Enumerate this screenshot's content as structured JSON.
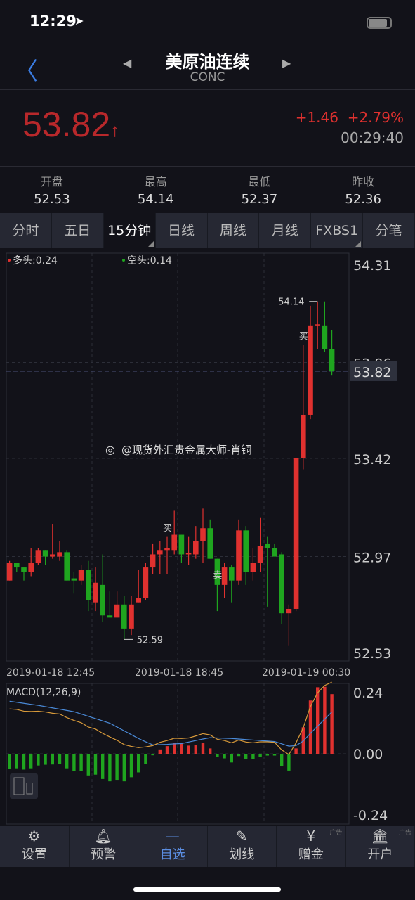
{
  "status": {
    "time": "12:29",
    "location_icon": "location-arrow-icon"
  },
  "header": {
    "title": "美原油连续",
    "subtitle": "CONC",
    "back_icon": "chevron-left-icon"
  },
  "quote": {
    "price": "53.82",
    "arrow": "↑",
    "change": "+1.46",
    "change_pct": "+2.79%",
    "time": "00:29:40",
    "up_color": "#e0312f"
  },
  "stats": [
    {
      "label": "开盘",
      "value": "52.53"
    },
    {
      "label": "最高",
      "value": "54.14"
    },
    {
      "label": "最低",
      "value": "52.37"
    },
    {
      "label": "昨收",
      "value": "52.36"
    }
  ],
  "tabs": [
    {
      "label": "分时"
    },
    {
      "label": "五日"
    },
    {
      "label": "15分钟",
      "active": true
    },
    {
      "label": "日线"
    },
    {
      "label": "周线"
    },
    {
      "label": "月线"
    },
    {
      "label": "FXBS1"
    },
    {
      "label": "分笔"
    }
  ],
  "chart_data": [
    {
      "type": "candlestick",
      "legend": [
        "多头:0.24",
        "空头:0.14"
      ],
      "ylim": [
        52.53,
        54.31
      ],
      "y_ticks": [
        "54.31",
        "53.86",
        "53.42",
        "52.97",
        "52.53"
      ],
      "current_price": "53.82",
      "x_ticks": [
        "2019-01-18 12:45",
        "2019-01-18 18:45",
        "2019-01-19 00:30"
      ],
      "high_label": "54.14",
      "low_label": "52.59",
      "signals": [
        {
          "index": 22,
          "label": "买"
        },
        {
          "index": 29,
          "label": "卖"
        },
        {
          "index": 41,
          "label": "买"
        }
      ],
      "watermark": "@现货外汇贵金属大师-肖铜",
      "colors": {
        "up": "#e0312f",
        "down": "#1fa51f"
      },
      "ohlc": [
        [
          52.86,
          52.94,
          52.95,
          52.86
        ],
        [
          52.94,
          52.92,
          52.94,
          52.9
        ],
        [
          52.92,
          52.9,
          52.92,
          52.86
        ],
        [
          52.9,
          52.94,
          53.01,
          52.88
        ],
        [
          52.94,
          53.0,
          53.01,
          52.93
        ],
        [
          53.0,
          52.97,
          53.0,
          52.93
        ],
        [
          52.97,
          52.98,
          53.12,
          52.96
        ],
        [
          52.97,
          52.99,
          53.04,
          52.95
        ],
        [
          52.99,
          52.86,
          53.0,
          52.86
        ],
        [
          52.87,
          52.86,
          52.9,
          52.8
        ],
        [
          52.86,
          52.91,
          52.93,
          52.84
        ],
        [
          52.91,
          52.77,
          52.95,
          52.72
        ],
        [
          52.76,
          52.85,
          52.92,
          52.72
        ],
        [
          52.84,
          52.7,
          52.98,
          52.67
        ],
        [
          52.7,
          52.69,
          52.81,
          52.69
        ],
        [
          52.69,
          52.75,
          52.81,
          52.69
        ],
        [
          52.75,
          52.64,
          52.79,
          52.59
        ],
        [
          52.64,
          52.75,
          52.79,
          52.61
        ],
        [
          52.76,
          52.78,
          52.91,
          52.76
        ],
        [
          52.78,
          52.92,
          52.94,
          52.77
        ],
        [
          52.92,
          52.98,
          53.03,
          52.89
        ],
        [
          52.98,
          53.0,
          53.04,
          52.89
        ],
        [
          53.0,
          53.01,
          53.06,
          52.89
        ],
        [
          53.0,
          53.07,
          53.18,
          52.98
        ],
        [
          53.07,
          52.98,
          53.07,
          52.94
        ],
        [
          52.98,
          52.985,
          53.06,
          52.93
        ],
        [
          52.98,
          53.04,
          53.11,
          52.96
        ],
        [
          53.04,
          53.1,
          53.19,
          52.94
        ],
        [
          53.1,
          52.96,
          53.14,
          52.96
        ],
        [
          52.96,
          52.84,
          52.96,
          52.72
        ],
        [
          52.84,
          52.92,
          52.94,
          52.78
        ],
        [
          52.92,
          52.86,
          52.93,
          52.76
        ],
        [
          52.86,
          53.09,
          53.14,
          52.84
        ],
        [
          53.09,
          52.9,
          53.11,
          52.84
        ],
        [
          52.9,
          52.94,
          53.01,
          52.86
        ],
        [
          52.94,
          53.02,
          53.15,
          52.9
        ],
        [
          53.03,
          53.01,
          53.06,
          52.74
        ],
        [
          53.01,
          52.97,
          53.03,
          52.97
        ],
        [
          52.98,
          52.71,
          52.99,
          52.66
        ],
        [
          52.71,
          52.73,
          52.75,
          52.56
        ],
        [
          52.73,
          53.42,
          53.42,
          52.72
        ],
        [
          53.42,
          53.62,
          53.94,
          53.37
        ],
        [
          53.62,
          54.03,
          54.12,
          53.6
        ],
        [
          54.03,
          54.035,
          54.14,
          53.92
        ],
        [
          54.03,
          53.92,
          54.14,
          53.91
        ],
        [
          53.92,
          53.82,
          54.01,
          53.8
        ]
      ]
    },
    {
      "type": "macd",
      "title": "MACD(12,26,9)",
      "ylim": [
        -0.24,
        0.24
      ],
      "y_ticks": [
        "0.24",
        "0.00",
        "-0.24"
      ],
      "colors": {
        "dif": "#d89a3a",
        "dea": "#4a8ad8"
      },
      "hist": [
        -0.06,
        -0.057,
        -0.062,
        -0.057,
        -0.046,
        -0.043,
        -0.042,
        -0.039,
        -0.057,
        -0.068,
        -0.068,
        -0.085,
        -0.082,
        -0.099,
        -0.108,
        -0.105,
        -0.108,
        -0.092,
        -0.073,
        -0.041,
        -0.006,
        0.017,
        0.03,
        0.044,
        0.04,
        0.032,
        0.035,
        0.042,
        0.021,
        -0.011,
        -0.018,
        -0.034,
        -0.009,
        -0.02,
        -0.022,
        -0.011,
        -0.007,
        -0.007,
        -0.048,
        -0.066,
        0.021,
        0.104,
        0.209,
        0.261,
        0.263,
        0.234
      ],
      "dif": [
        0.176,
        0.174,
        0.167,
        0.166,
        0.167,
        0.164,
        0.159,
        0.156,
        0.142,
        0.131,
        0.122,
        0.105,
        0.097,
        0.08,
        0.066,
        0.053,
        0.036,
        0.029,
        0.024,
        0.027,
        0.032,
        0.045,
        0.052,
        0.061,
        0.06,
        0.062,
        0.07,
        0.079,
        0.074,
        0.057,
        0.052,
        0.043,
        0.054,
        0.046,
        0.043,
        0.047,
        0.047,
        0.045,
        0.015,
        -0.003,
        0.043,
        0.102,
        0.185,
        0.239,
        0.268,
        0.281
      ],
      "dea": [
        0.206,
        0.202,
        0.198,
        0.194,
        0.19,
        0.185,
        0.18,
        0.175,
        0.17,
        0.165,
        0.156,
        0.147,
        0.138,
        0.129,
        0.12,
        0.105,
        0.09,
        0.075,
        0.06,
        0.047,
        0.035,
        0.036,
        0.037,
        0.039,
        0.04,
        0.046,
        0.052,
        0.058,
        0.063,
        0.062,
        0.061,
        0.06,
        0.058,
        0.056,
        0.054,
        0.052,
        0.05,
        0.048,
        0.039,
        0.03,
        0.032,
        0.05,
        0.08,
        0.108,
        0.136,
        0.164
      ]
    }
  ],
  "bottom_nav": [
    {
      "label": "设置",
      "icon": "gear-icon"
    },
    {
      "label": "预警",
      "icon": "bell-icon"
    },
    {
      "label": "自选",
      "icon": "minus-icon",
      "active": true
    },
    {
      "label": "划线",
      "icon": "pen-icon"
    },
    {
      "label": "赠金",
      "icon": "yen-icon",
      "ad": "广告"
    },
    {
      "label": "开户",
      "icon": "bank-icon",
      "ad": "广告"
    }
  ]
}
